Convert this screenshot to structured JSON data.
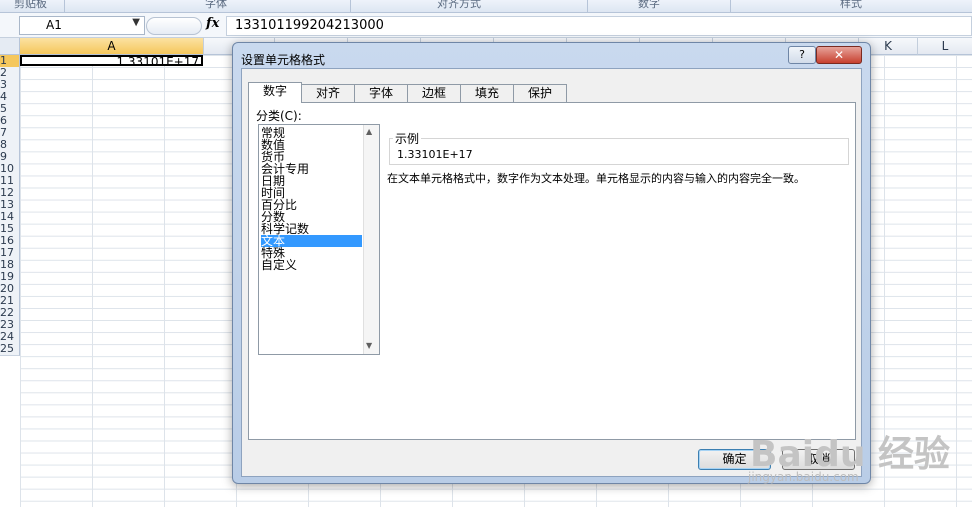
{
  "ribbon": {
    "groups": [
      "剪贴板",
      "字体",
      "对齐方式",
      "数字",
      "样式"
    ]
  },
  "formula_bar": {
    "name_box": "A1",
    "fx_label": "fx",
    "formula": "133101199204213000"
  },
  "sheet": {
    "columns": [
      "A",
      "K",
      "L"
    ],
    "rows": [
      "1",
      "2",
      "3",
      "4",
      "5",
      "6",
      "7",
      "8",
      "9",
      "10",
      "11",
      "12",
      "13",
      "14",
      "15",
      "16",
      "17",
      "18",
      "19",
      "20",
      "21",
      "22",
      "23",
      "24",
      "25"
    ],
    "cell_a1": "1.33101E+17"
  },
  "dialog": {
    "title": "设置单元格格式",
    "help": "?",
    "close": "✕",
    "tabs": [
      "数字",
      "对齐",
      "字体",
      "边框",
      "填充",
      "保护"
    ],
    "active_tab": "数字",
    "category_label": "分类(C):",
    "categories": [
      "常规",
      "数值",
      "货币",
      "会计专用",
      "日期",
      "时间",
      "百分比",
      "分数",
      "科学记数",
      "文本",
      "特殊",
      "自定义"
    ],
    "selected_category": "文本",
    "sample_label": "示例",
    "sample_value": "1.33101E+17",
    "description": "在文本单元格格式中，数字作为文本处理。单元格显示的内容与输入的内容完全一致。",
    "ok_label": "确定",
    "cancel_label": "取消"
  },
  "watermark": {
    "main": "Baidu 经验",
    "sub": "jingyan.baidu.com"
  }
}
